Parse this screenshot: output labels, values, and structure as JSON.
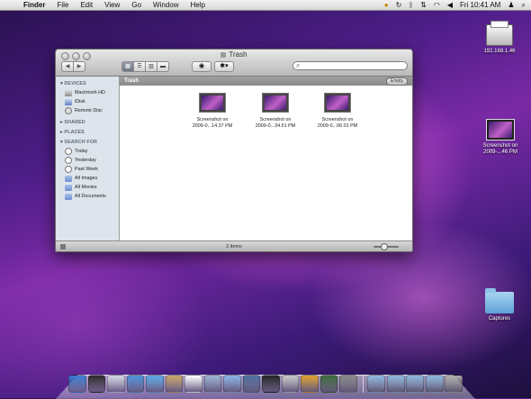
{
  "menubar": {
    "apple": "",
    "app": "Finder",
    "menus": [
      "File",
      "Edit",
      "View",
      "Go",
      "Window",
      "Help"
    ],
    "clock": "Fri 10:41 AM"
  },
  "window": {
    "title": "Trash",
    "search_placeholder": "",
    "path_label": "Trash",
    "empty_button": "Empty",
    "status": "3 items",
    "sidebar": {
      "devices_header": "DEVICES",
      "devices": [
        "Macintosh HD",
        "iDisk",
        "Remote Disc"
      ],
      "shared_header": "SHARED",
      "places_header": "PLACES",
      "search_header": "SEARCH FOR",
      "searches": [
        "Today",
        "Yesterday",
        "Past Week",
        "All Images",
        "All Movies",
        "All Documents"
      ]
    },
    "files": [
      {
        "line1": "Screenshot on",
        "line2": "2009-0...14.37 PM"
      },
      {
        "line1": "Screenshot on",
        "line2": "2009-0...34.51 PM"
      },
      {
        "line1": "Screenshot on",
        "line2": "2009-0...06.01 PM"
      }
    ]
  },
  "desktop": {
    "printer_label": "192.168.1.46",
    "screenshot_line1": "Screenshot on",
    "screenshot_line2": "2009-...46 PM",
    "folder_label": "Captures"
  },
  "dock": {
    "icons": [
      "finder-icon",
      "dashboard-icon",
      "mail-icon",
      "safari-icon",
      "ichat-icon",
      "address-book-icon",
      "ical-icon",
      "preview-icon",
      "itunes-icon",
      "iphoto-icon",
      "photobooth-icon",
      "imovie-icon",
      "garageband-icon",
      "time-machine-icon",
      "system-preferences-icon",
      "applications-folder-icon",
      "documents-folder-icon",
      "downloads-folder-icon",
      "captures-folder-icon",
      "trash-icon"
    ],
    "colors": [
      "#3b7fd4",
      "#2a2a2a",
      "#d0d8e4",
      "#4a90d9",
      "#5aa9e6",
      "#c8a46a",
      "#ffffff",
      "#9ab3d4",
      "#8ab4e8",
      "#4f6f9f",
      "#222222",
      "#c8c8c8",
      "#e0a030",
      "#3a6a3a",
      "#888888",
      "#8fb8e0",
      "#8fb8e0",
      "#8fb8e0",
      "#8fb8e0",
      "#b0b0b0"
    ]
  }
}
